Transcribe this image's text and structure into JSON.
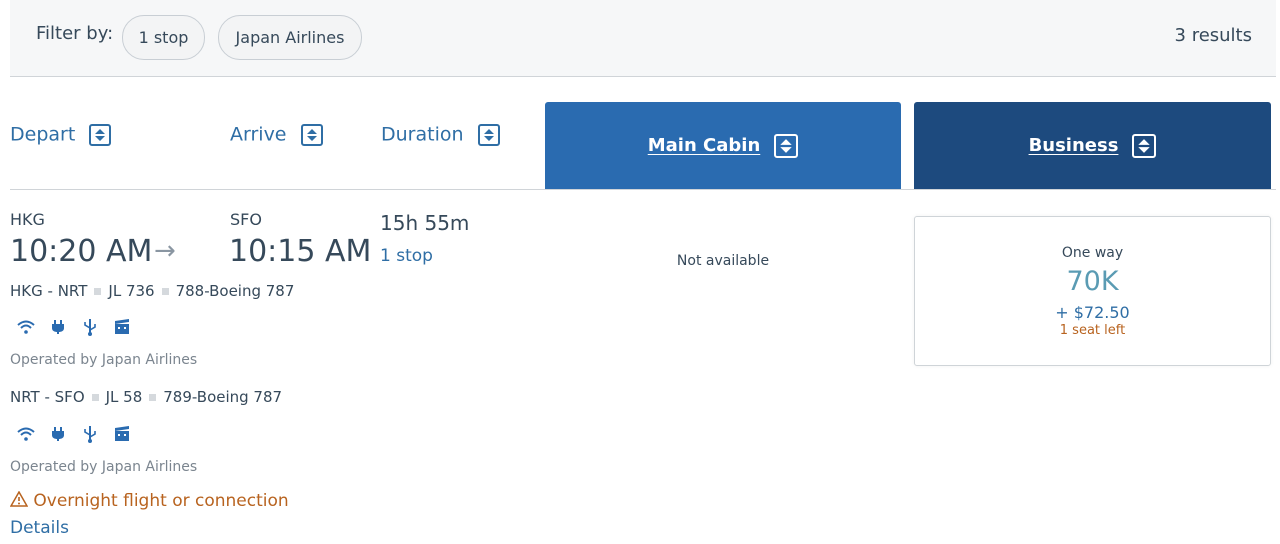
{
  "filter": {
    "label": "Filter by:",
    "pills": [
      "1 stop",
      "Japan Airlines"
    ],
    "results": "3 results"
  },
  "headers": {
    "depart": "Depart",
    "arrive": "Arrive",
    "duration": "Duration",
    "main_cabin": "Main Cabin",
    "business": "Business"
  },
  "colors": {
    "main_cabin": "#2a6bb0",
    "business": "#1d4a7e",
    "link": "#2f6ea5",
    "warning": "#b8631f"
  },
  "flight": {
    "depart_code": "HKG",
    "depart_time": "10:20 AM",
    "arrive_code": "SFO",
    "arrive_time": "10:15 AM",
    "duration": "15h 55m",
    "stops": "1 stop",
    "segments": [
      {
        "route": "HKG - NRT",
        "flight_no": "JL 736",
        "aircraft": "788-Boeing 787",
        "amenities": [
          "wifi-icon",
          "power-outlet-icon",
          "usb-icon",
          "entertainment-icon"
        ],
        "operated_by": "Operated by Japan Airlines"
      },
      {
        "route": "NRT - SFO",
        "flight_no": "JL 58",
        "aircraft": "789-Boeing 787",
        "amenities": [
          "wifi-icon",
          "power-outlet-icon",
          "usb-icon",
          "entertainment-icon"
        ],
        "operated_by": "Operated by Japan Airlines"
      }
    ],
    "warning": "Overnight flight or connection",
    "details": "Details",
    "main_cabin_status": "Not available",
    "business_fare": {
      "trip_type": "One way",
      "miles": "70K",
      "taxes": "+ $72.50",
      "seats": "1 seat left"
    }
  }
}
